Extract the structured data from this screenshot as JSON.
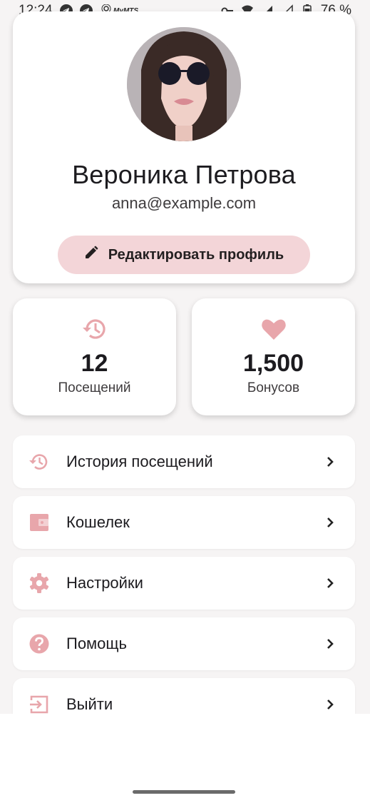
{
  "status_bar": {
    "time": "12:24",
    "battery": "76 %",
    "icons_left": [
      "telegram-icon",
      "telegram-icon",
      "network-icon",
      "mts-icon"
    ],
    "mts_text": "MyMTS",
    "icons_right": [
      "key-icon",
      "wifi-icon",
      "signal-icon",
      "signal-icon",
      "battery-icon"
    ]
  },
  "profile": {
    "name": "Вероника Петрова",
    "email": "anna@example.com",
    "edit_label": "Редактировать профиль"
  },
  "stats": [
    {
      "value": "12",
      "label": "Посещений",
      "icon": "history-icon"
    },
    {
      "value": "1,500",
      "label": "Бонусов",
      "icon": "heart-icon"
    }
  ],
  "menu": [
    {
      "label": "История посещений",
      "icon": "history-icon"
    },
    {
      "label": "Кошелек",
      "icon": "wallet-icon"
    },
    {
      "label": "Настройки",
      "icon": "gear-icon"
    },
    {
      "label": "Помощь",
      "icon": "help-icon"
    },
    {
      "label": "Выйти",
      "icon": "logout-icon"
    }
  ],
  "colors": {
    "accent": "#e8a6ab",
    "button_bg": "#f3d5d8",
    "background": "#f6f4f4",
    "card": "#ffffff"
  }
}
